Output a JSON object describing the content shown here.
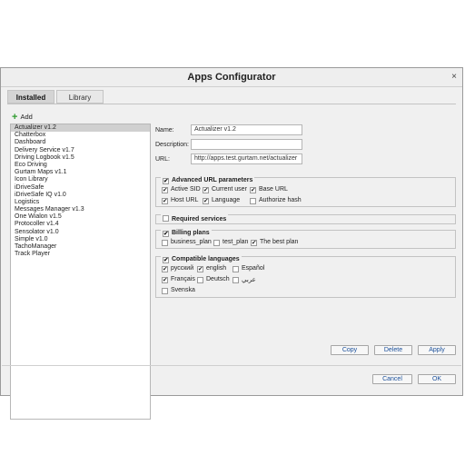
{
  "dialog": {
    "title": "Apps Configurator",
    "close_glyph": "×"
  },
  "tabs": [
    {
      "label": "Installed",
      "active": true
    },
    {
      "label": "Library",
      "active": false
    }
  ],
  "add_label": "Add",
  "apps": [
    "Actualizer v1.2",
    "Chatterbox",
    "Dashboard",
    "Delivery Service v1.7",
    "Driving Logbook v1.5",
    "Eco Driving",
    "Gurtam Maps v1.1",
    "Icon Library",
    "iDriveSafe",
    "iDriveSafe IQ v1.0",
    "Logistics",
    "Messages Manager v1.3",
    "One Wialon v1.5",
    "Protocoller v1.4",
    "Sensolator v1.0",
    "Simple v1.0",
    "TachoManager",
    "Track Player"
  ],
  "selected_app": "Actualizer v1.2",
  "form": {
    "name_label": "Name:",
    "name_value": "Actualizer v1.2",
    "description_label": "Description:",
    "description_value": "",
    "url_label": "URL:",
    "url_value": "http://apps.test.gurtam.net/actualizer"
  },
  "advanced": {
    "title": "Advanced URL parameters",
    "options": [
      {
        "label": "Active SID",
        "checked": true
      },
      {
        "label": "Current user",
        "checked": true
      },
      {
        "label": "Base URL",
        "checked": true
      },
      {
        "label": "Host URL",
        "checked": true
      },
      {
        "label": "Language",
        "checked": true
      },
      {
        "label": "Authorize hash",
        "checked": false
      }
    ]
  },
  "required_services": {
    "title": "Required services",
    "checked": false
  },
  "billing": {
    "title": "Billing plans",
    "options": [
      {
        "label": "business_plan",
        "checked": false
      },
      {
        "label": "test_plan",
        "checked": false
      },
      {
        "label": "The best plan",
        "checked": true
      }
    ]
  },
  "languages": {
    "title": "Compatible languages",
    "options": [
      {
        "label": "русский",
        "checked": true
      },
      {
        "label": "english",
        "checked": true
      },
      {
        "label": "Español",
        "checked": false
      },
      {
        "label": "Français",
        "checked": true
      },
      {
        "label": "Deutsch",
        "checked": false
      },
      {
        "label": "عربي",
        "checked": false
      },
      {
        "label": "Svenska",
        "checked": false
      }
    ]
  },
  "actions": {
    "copy": "Copy",
    "delete": "Delete",
    "apply": "Apply"
  },
  "footer": {
    "cancel": "Cancel",
    "ok": "OK"
  },
  "colors": {
    "add_icon": "#2e9b2e",
    "button_text": "#1a4f9a"
  }
}
